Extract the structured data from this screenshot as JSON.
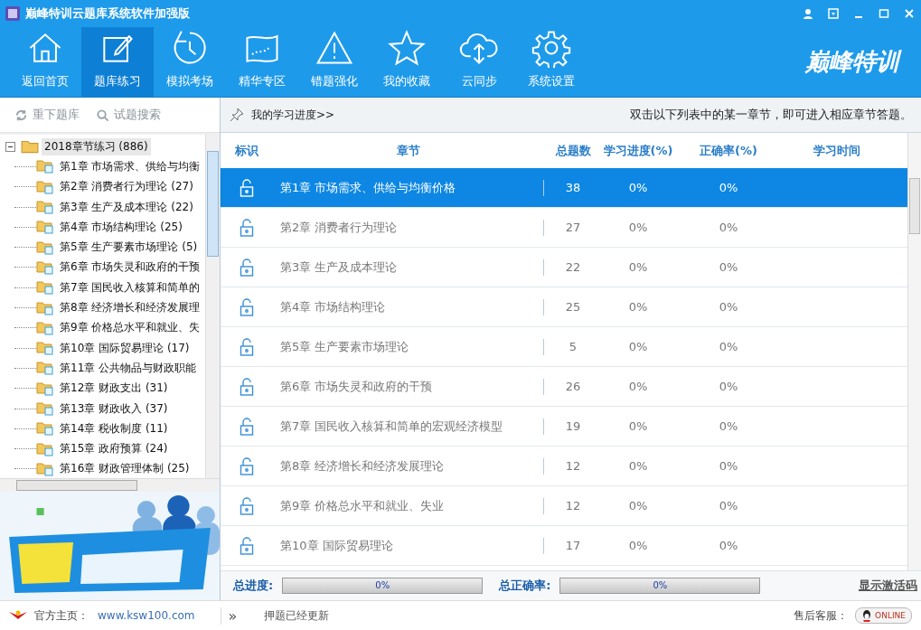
{
  "window": {
    "title": "巅峰特训云题库系统软件加强版"
  },
  "toolbar": [
    {
      "label": "返回首页",
      "selected": false
    },
    {
      "label": "题库练习",
      "selected": true
    },
    {
      "label": "模拟考场",
      "selected": false
    },
    {
      "label": "精华专区",
      "selected": false
    },
    {
      "label": "错题强化",
      "selected": false
    },
    {
      "label": "我的收藏",
      "selected": false
    },
    {
      "label": "云同步",
      "selected": false
    },
    {
      "label": "系统设置",
      "selected": false
    }
  ],
  "logo": "巅峰特训",
  "sidebar": {
    "actions": [
      {
        "label": "重下题库"
      },
      {
        "label": "试题搜索"
      }
    ],
    "tree": [
      {
        "label": "2018章节练习 (886)",
        "expanded": true,
        "selected": true,
        "children": [
          {
            "label": "第1章  市场需求、供给与均衡",
            "selected": false
          },
          {
            "label": "第2章  消费者行为理论 (27)",
            "selected": false
          },
          {
            "label": "第3章  生产及成本理论 (22)",
            "selected": false
          },
          {
            "label": "第4章  市场结构理论 (25)",
            "selected": false
          },
          {
            "label": "第5章  生产要素市场理论 (5)",
            "selected": false
          },
          {
            "label": "第6章  市场失灵和政府的干预",
            "selected": false
          },
          {
            "label": "第7章  国民收入核算和简单的",
            "selected": false
          },
          {
            "label": "第8章  经济增长和经济发展理",
            "selected": false
          },
          {
            "label": "第9章  价格总水平和就业、失",
            "selected": false
          },
          {
            "label": "第10章  国际贸易理论 (17)",
            "selected": false
          },
          {
            "label": "第11章  公共物品与财政职能",
            "selected": false
          },
          {
            "label": "第12章  财政支出 (31)",
            "selected": false
          },
          {
            "label": "第13章  财政收入 (37)",
            "selected": false
          },
          {
            "label": "第14章  税收制度 (11)",
            "selected": false
          },
          {
            "label": "第15章  政府预算 (24)",
            "selected": false
          },
          {
            "label": "第16章  财政管理体制 (25)",
            "selected": false
          }
        ]
      }
    ]
  },
  "progress_header": {
    "title": "我的学习进度>>",
    "hint": "双击以下列表中的某一章节，即可进入相应章节答题。"
  },
  "table": {
    "columns": [
      "标识",
      "章节",
      "总题数",
      "学习进度(%)",
      "正确率(%)",
      "学习时间"
    ],
    "rows": [
      {
        "chapter": "第1章 市场需求、供给与均衡价格",
        "total": "38",
        "progress": "0%",
        "accuracy": "0%",
        "selected": true
      },
      {
        "chapter": "第2章 消费者行为理论",
        "total": "27",
        "progress": "0%",
        "accuracy": "0%",
        "selected": false
      },
      {
        "chapter": "第3章 生产及成本理论",
        "total": "22",
        "progress": "0%",
        "accuracy": "0%",
        "selected": false
      },
      {
        "chapter": "第4章 市场结构理论",
        "total": "25",
        "progress": "0%",
        "accuracy": "0%",
        "selected": false
      },
      {
        "chapter": "第5章 生产要素市场理论",
        "total": "5",
        "progress": "0%",
        "accuracy": "0%",
        "selected": false
      },
      {
        "chapter": "第6章 市场失灵和政府的干预",
        "total": "26",
        "progress": "0%",
        "accuracy": "0%",
        "selected": false
      },
      {
        "chapter": "第7章 国民收入核算和简单的宏观经济模型",
        "total": "19",
        "progress": "0%",
        "accuracy": "0%",
        "selected": false
      },
      {
        "chapter": "第8章 经济增长和经济发展理论",
        "total": "12",
        "progress": "0%",
        "accuracy": "0%",
        "selected": false
      },
      {
        "chapter": "第9章 价格总水平和就业、失业",
        "total": "12",
        "progress": "0%",
        "accuracy": "0%",
        "selected": false
      },
      {
        "chapter": "第10章 国际贸易理论",
        "total": "17",
        "progress": "0%",
        "accuracy": "0%",
        "selected": false
      }
    ]
  },
  "summary": [
    {
      "label": "总进度:",
      "level": 0,
      "reading": "0%"
    },
    {
      "label": "总正确率:",
      "level": 0,
      "reading": "0%"
    }
  ],
  "activation_link": "显示激活码",
  "status_bar": {
    "home_label": "官方主页：",
    "home_url": "www.ksw100.com",
    "expand": "»",
    "notice": "押题已经更新",
    "support_label": "售后客服：",
    "online": "ONLINE"
  }
}
